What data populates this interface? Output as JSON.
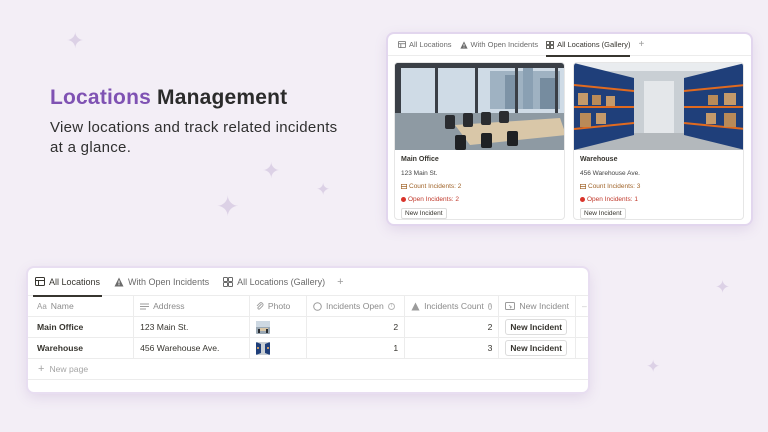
{
  "hero": {
    "title_accent": "Locations",
    "title_rest": " Management",
    "subtitle": "View locations and track related incidents  at a glance."
  },
  "colors": {
    "background": "#f3eef6",
    "accent": "#7f52b3",
    "sparkle": "#dcd1e6",
    "open_incidents": "#c0392b",
    "count_incidents": "#a0642a"
  },
  "tabs": [
    {
      "label": "All Locations",
      "icon": "table-icon"
    },
    {
      "label": "With Open Incidents",
      "icon": "filter-icon"
    },
    {
      "label": "All Locations (Gallery)",
      "icon": "gallery-icon"
    }
  ],
  "gallery_panel": {
    "active_tab": 2
  },
  "table_panel": {
    "active_tab": 0
  },
  "gallery": {
    "cards": [
      {
        "title": "Main Office",
        "address": "123 Main St.",
        "count_label": "Count Incidents: 2",
        "open_label": "Open Incidents: 2",
        "button": "New Incident",
        "image": "office-photo"
      },
      {
        "title": "Warehouse",
        "address": "456 Warehouse Ave.",
        "count_label": "Count Incidents: 3",
        "open_label": "Open Incidents: 1",
        "button": "New Incident",
        "image": "warehouse-photo"
      }
    ]
  },
  "table": {
    "headers": {
      "name": "Name",
      "address": "Address",
      "photo": "Photo",
      "incidents_open": "Incidents Open",
      "incidents_count": "Incidents Count",
      "new_incident": "New Incident"
    },
    "rows": [
      {
        "name": "Main Office",
        "address": "123 Main St.",
        "photo": "office-photo",
        "incidents_open": "2",
        "incidents_count": "2",
        "button": "New Incident"
      },
      {
        "name": "Warehouse",
        "address": "456 Warehouse Ave.",
        "photo": "warehouse-photo",
        "incidents_open": "1",
        "incidents_count": "3",
        "button": "New Incident"
      }
    ],
    "new_page": "New page"
  }
}
